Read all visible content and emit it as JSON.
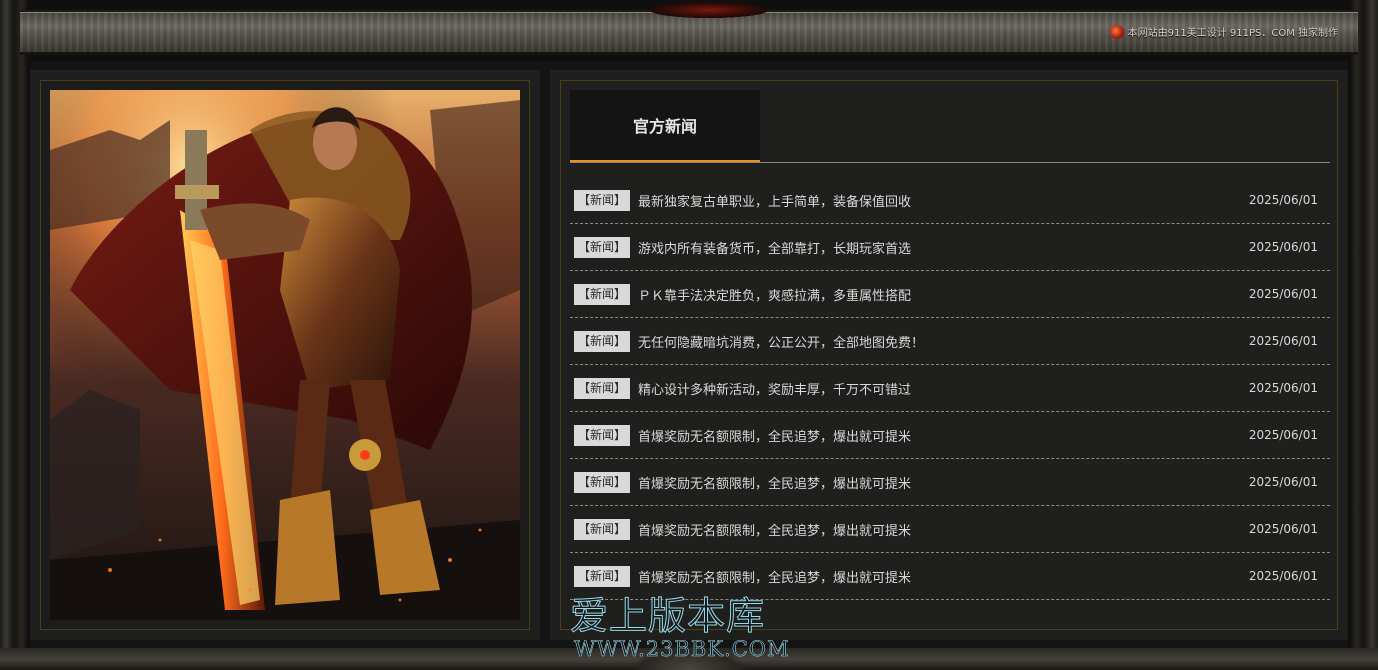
{
  "header": {
    "credit_text": "本网站由911美工设计 911PS．COM 独家制作"
  },
  "tabs": [
    {
      "label": "官方新闻",
      "active": true
    }
  ],
  "news": [
    {
      "tag": "【新闻】",
      "title": "最新独家复古单职业，上手简单，装备保值回收",
      "date": "2025/06/01"
    },
    {
      "tag": "【新闻】",
      "title": "游戏内所有装备货币，全部靠打，长期玩家首选",
      "date": "2025/06/01"
    },
    {
      "tag": "【新闻】",
      "title": "ＰＫ靠手法决定胜负，爽感拉满，多重属性搭配",
      "date": "2025/06/01"
    },
    {
      "tag": "【新闻】",
      "title": "无任何隐藏暗坑消费，公正公开，全部地图免费！",
      "date": "2025/06/01"
    },
    {
      "tag": "【新闻】",
      "title": "精心设计多种新活动，奖励丰厚，千万不可错过",
      "date": "2025/06/01"
    },
    {
      "tag": "【新闻】",
      "title": "首爆奖励无名额限制，全民追梦，爆出就可提米",
      "date": "2025/06/01"
    },
    {
      "tag": "【新闻】",
      "title": "首爆奖励无名额限制，全民追梦，爆出就可提米",
      "date": "2025/06/01"
    },
    {
      "tag": "【新闻】",
      "title": "首爆奖励无名额限制，全民追梦，爆出就可提米",
      "date": "2025/06/01"
    },
    {
      "tag": "【新闻】",
      "title": "首爆奖励无名额限制，全民追梦，爆出就可提米",
      "date": "2025/06/01"
    }
  ],
  "watermark": {
    "brand": "爱上版本库",
    "url": "WWW.23BBK.COM"
  },
  "colors": {
    "accent": "#e8931c",
    "panel_border": "#4b3d1a",
    "panel_bg": "#1f1f1d",
    "text": "#d8d8d8"
  },
  "icons": {
    "hero_image": "armored-warrior-with-flaming-sword",
    "credit_logo": "round-red-logo-icon"
  }
}
